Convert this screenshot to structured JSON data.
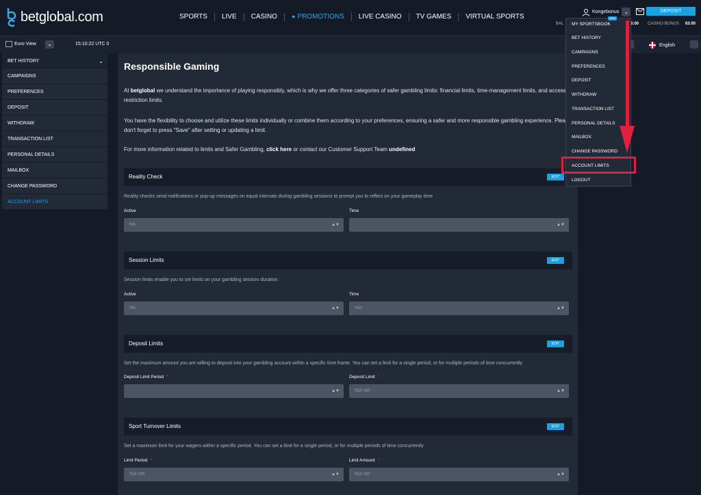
{
  "brand": {
    "name": "betglobal.com"
  },
  "nav": [
    {
      "label": "SPORTS"
    },
    {
      "label": "LIVE"
    },
    {
      "label": "CASINO"
    },
    {
      "label": "PROMOTIONS"
    },
    {
      "label": "LIVE CASINO"
    },
    {
      "label": "TV GAMES"
    },
    {
      "label": "VIRTUAL SPORTS"
    }
  ],
  "user": {
    "name": "Kongebonus",
    "deposit_label": "DEPOSIT"
  },
  "balances": {
    "bal_label": "BAL",
    "bal_value": "€0.00",
    "casino_label": "CASINO BONUS",
    "casino_value": "€0.00"
  },
  "subbar": {
    "view_label": "Euro View",
    "clock": "15:10:22 UTC 0",
    "language": "English"
  },
  "sidebar": [
    {
      "label": "BET HISTORY"
    },
    {
      "label": "CAMPAIGNS"
    },
    {
      "label": "PREFERENCES"
    },
    {
      "label": "DEPOSIT"
    },
    {
      "label": "WITHDRAW"
    },
    {
      "label": "TRANSACTION LIST"
    },
    {
      "label": "PERSONAL DETAILS"
    },
    {
      "label": "MAILBOX"
    },
    {
      "label": "CHANGE PASSWORD"
    },
    {
      "label": "ACCOUNT LIMITS"
    }
  ],
  "main": {
    "title": "Responsible Gaming",
    "p1_pre": "At ",
    "p1_brand": "betglobal",
    "p1_post": " we understand the importance of playing responsibly, which is why we offer three categories of safer gambling limits: financial limits, time-management limits, and access restriction limits.",
    "p2": "You have the flexibility to choose and utilize these limits individually or combine them according to your preferences, ensuring a safer and more responsible gambling experience. Please don't forget to press \"Save\" after setting or updating a limit.",
    "p3_pre": "For more information related to limits and Safer Gambling, ",
    "p3_link": "click here",
    "p3_mid": " or contact our Customer Support Team ",
    "p3_end": "undefined",
    "edit_label": "EDIT"
  },
  "sections": {
    "reality": {
      "title": "Reality Check",
      "desc": "Reality checks send notifications or pop-up messages on equal intervals during gambling sessions to prompt you to reflect on your gameplay time",
      "f1_label": "Active",
      "f1_value": "No",
      "f2_label": "Time",
      "f2_value": ""
    },
    "session": {
      "title": "Session Limits",
      "desc": "Session limits enable you to set limits on your gambling session duration.",
      "f1_label": "Active",
      "f1_value": "No",
      "f2_label": "Time",
      "f2_value": "min"
    },
    "deposit": {
      "title": "Deposit Limits",
      "desc": "Set the maximum amount you are willing to deposit into your gambling account within a specific time frame. You can set a limit for a single period, or for multiple periods of time concurrently",
      "f1_label": "Deposit Limit Period",
      "f1_value": "",
      "f2_label": "Deposit Limit",
      "f2_value": "Not set"
    },
    "turnover": {
      "title": "Sport Turnover Limits",
      "desc": "Set a maximum limit for your wagers within a specific period. You can set a limit for a single period, or for multiple periods of time concurrently",
      "f1_label": "Limit Period",
      "f1_value": "Not set",
      "f2_label": "Limit Amount",
      "f2_value": "Not set"
    }
  },
  "dropdown": {
    "new_badge": "NEW",
    "items": [
      {
        "label": "MY SPORTSBOOK"
      },
      {
        "label": "BET HISTORY"
      },
      {
        "label": "CAMPAIGNS"
      },
      {
        "label": "PREFERENCES"
      },
      {
        "label": "DEPOSIT"
      },
      {
        "label": "WITHDRAW"
      },
      {
        "label": "TRANSACTION LIST"
      },
      {
        "label": "PERSONAL DETAILS"
      },
      {
        "label": "MAILBOX"
      },
      {
        "label": "CHANGE PASSWORD"
      },
      {
        "label": "ACCOUNT LIMITS"
      },
      {
        "label": "LOGOUT"
      }
    ]
  },
  "colors": {
    "accent": "#1ea0e0",
    "highlight": "#e0213d",
    "background": "#141a26",
    "panel": "#222a38"
  }
}
